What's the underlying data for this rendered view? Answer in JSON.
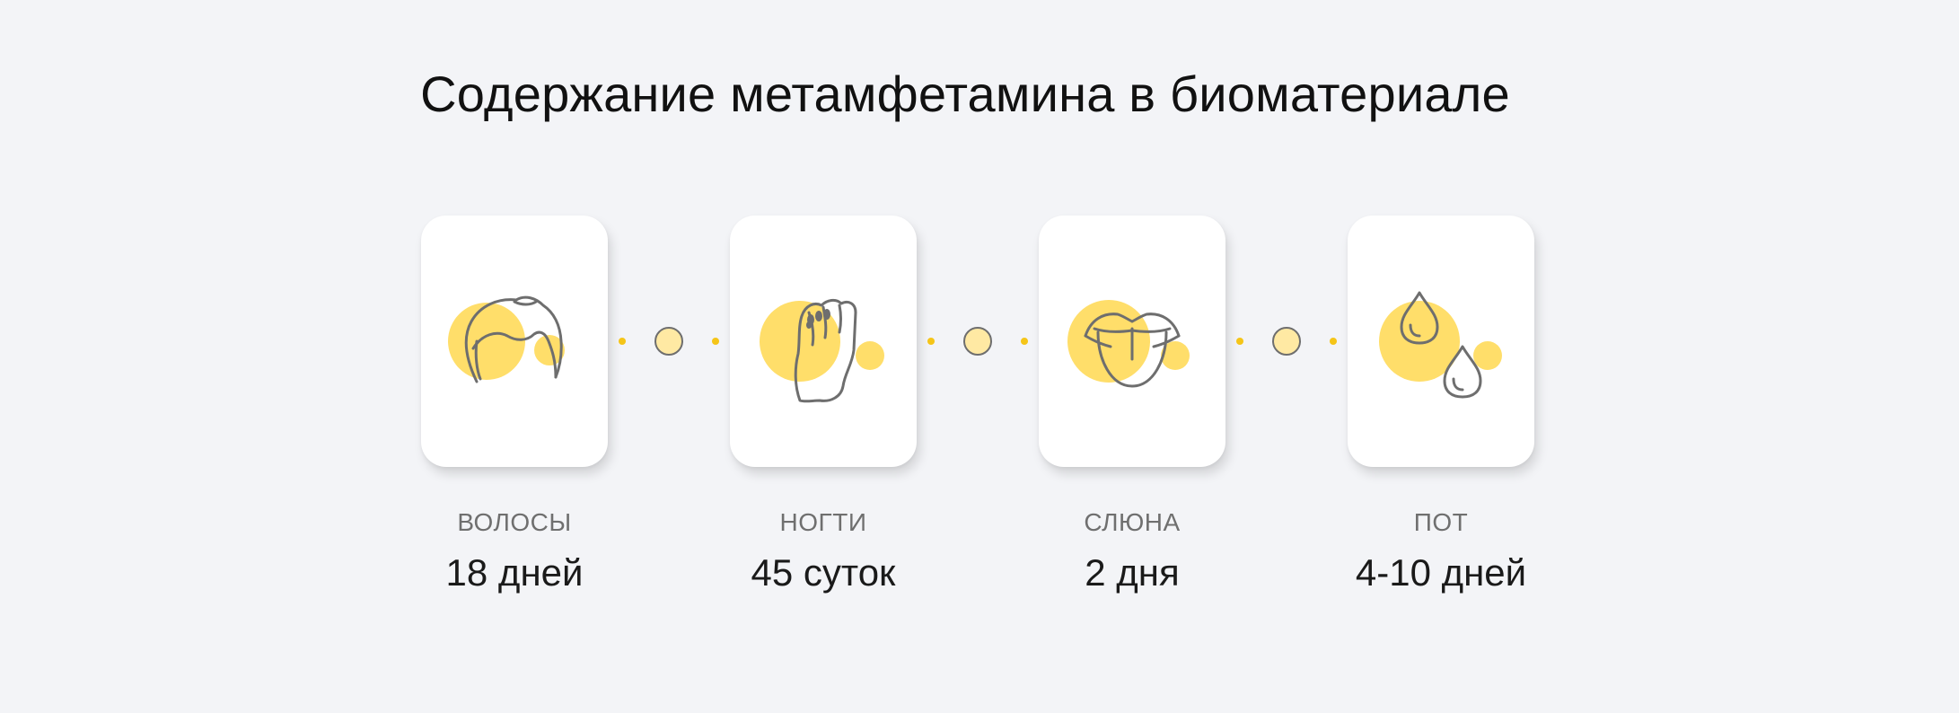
{
  "title": "Содержание метамфетамина в биоматериале",
  "colors": {
    "background": "#f3f4f7",
    "card": "#ffffff",
    "accent_yellow": "#ffde6a",
    "dot_yellow": "#f5c518",
    "icon_stroke": "#6e6e6e"
  },
  "items": [
    {
      "label": "ВОЛОСЫ",
      "value": "18 дней",
      "icon": "hair-icon"
    },
    {
      "label": "НОГТИ",
      "value": "45 суток",
      "icon": "fist-nails-icon"
    },
    {
      "label": "СЛЮНА",
      "value": "2 дня",
      "icon": "tongue-icon"
    },
    {
      "label": "ПОТ",
      "value": "4-10 дней",
      "icon": "sweat-drops-icon"
    }
  ]
}
